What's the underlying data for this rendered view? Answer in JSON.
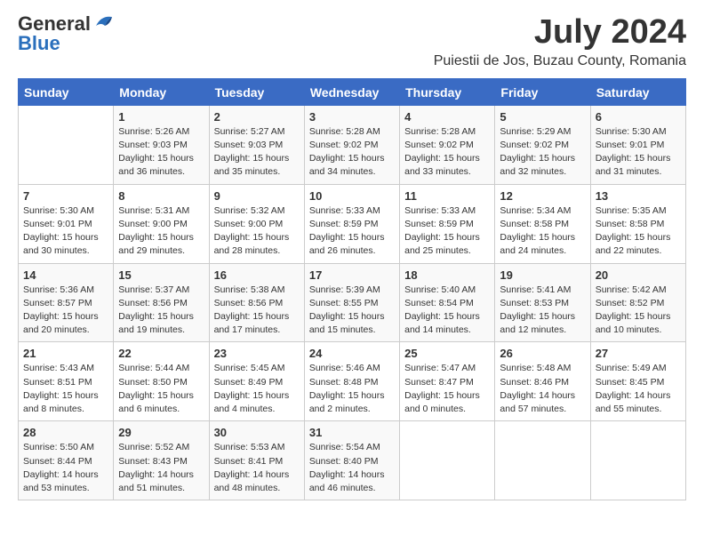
{
  "header": {
    "logo_general": "General",
    "logo_blue": "Blue",
    "month": "July 2024",
    "location": "Puiestii de Jos, Buzau County, Romania"
  },
  "weekdays": [
    "Sunday",
    "Monday",
    "Tuesday",
    "Wednesday",
    "Thursday",
    "Friday",
    "Saturday"
  ],
  "weeks": [
    [
      {
        "day": "",
        "info": ""
      },
      {
        "day": "1",
        "info": "Sunrise: 5:26 AM\nSunset: 9:03 PM\nDaylight: 15 hours\nand 36 minutes."
      },
      {
        "day": "2",
        "info": "Sunrise: 5:27 AM\nSunset: 9:03 PM\nDaylight: 15 hours\nand 35 minutes."
      },
      {
        "day": "3",
        "info": "Sunrise: 5:28 AM\nSunset: 9:02 PM\nDaylight: 15 hours\nand 34 minutes."
      },
      {
        "day": "4",
        "info": "Sunrise: 5:28 AM\nSunset: 9:02 PM\nDaylight: 15 hours\nand 33 minutes."
      },
      {
        "day": "5",
        "info": "Sunrise: 5:29 AM\nSunset: 9:02 PM\nDaylight: 15 hours\nand 32 minutes."
      },
      {
        "day": "6",
        "info": "Sunrise: 5:30 AM\nSunset: 9:01 PM\nDaylight: 15 hours\nand 31 minutes."
      }
    ],
    [
      {
        "day": "7",
        "info": "Sunrise: 5:30 AM\nSunset: 9:01 PM\nDaylight: 15 hours\nand 30 minutes."
      },
      {
        "day": "8",
        "info": "Sunrise: 5:31 AM\nSunset: 9:00 PM\nDaylight: 15 hours\nand 29 minutes."
      },
      {
        "day": "9",
        "info": "Sunrise: 5:32 AM\nSunset: 9:00 PM\nDaylight: 15 hours\nand 28 minutes."
      },
      {
        "day": "10",
        "info": "Sunrise: 5:33 AM\nSunset: 8:59 PM\nDaylight: 15 hours\nand 26 minutes."
      },
      {
        "day": "11",
        "info": "Sunrise: 5:33 AM\nSunset: 8:59 PM\nDaylight: 15 hours\nand 25 minutes."
      },
      {
        "day": "12",
        "info": "Sunrise: 5:34 AM\nSunset: 8:58 PM\nDaylight: 15 hours\nand 24 minutes."
      },
      {
        "day": "13",
        "info": "Sunrise: 5:35 AM\nSunset: 8:58 PM\nDaylight: 15 hours\nand 22 minutes."
      }
    ],
    [
      {
        "day": "14",
        "info": "Sunrise: 5:36 AM\nSunset: 8:57 PM\nDaylight: 15 hours\nand 20 minutes."
      },
      {
        "day": "15",
        "info": "Sunrise: 5:37 AM\nSunset: 8:56 PM\nDaylight: 15 hours\nand 19 minutes."
      },
      {
        "day": "16",
        "info": "Sunrise: 5:38 AM\nSunset: 8:56 PM\nDaylight: 15 hours\nand 17 minutes."
      },
      {
        "day": "17",
        "info": "Sunrise: 5:39 AM\nSunset: 8:55 PM\nDaylight: 15 hours\nand 15 minutes."
      },
      {
        "day": "18",
        "info": "Sunrise: 5:40 AM\nSunset: 8:54 PM\nDaylight: 15 hours\nand 14 minutes."
      },
      {
        "day": "19",
        "info": "Sunrise: 5:41 AM\nSunset: 8:53 PM\nDaylight: 15 hours\nand 12 minutes."
      },
      {
        "day": "20",
        "info": "Sunrise: 5:42 AM\nSunset: 8:52 PM\nDaylight: 15 hours\nand 10 minutes."
      }
    ],
    [
      {
        "day": "21",
        "info": "Sunrise: 5:43 AM\nSunset: 8:51 PM\nDaylight: 15 hours\nand 8 minutes."
      },
      {
        "day": "22",
        "info": "Sunrise: 5:44 AM\nSunset: 8:50 PM\nDaylight: 15 hours\nand 6 minutes."
      },
      {
        "day": "23",
        "info": "Sunrise: 5:45 AM\nSunset: 8:49 PM\nDaylight: 15 hours\nand 4 minutes."
      },
      {
        "day": "24",
        "info": "Sunrise: 5:46 AM\nSunset: 8:48 PM\nDaylight: 15 hours\nand 2 minutes."
      },
      {
        "day": "25",
        "info": "Sunrise: 5:47 AM\nSunset: 8:47 PM\nDaylight: 15 hours\nand 0 minutes."
      },
      {
        "day": "26",
        "info": "Sunrise: 5:48 AM\nSunset: 8:46 PM\nDaylight: 14 hours\nand 57 minutes."
      },
      {
        "day": "27",
        "info": "Sunrise: 5:49 AM\nSunset: 8:45 PM\nDaylight: 14 hours\nand 55 minutes."
      }
    ],
    [
      {
        "day": "28",
        "info": "Sunrise: 5:50 AM\nSunset: 8:44 PM\nDaylight: 14 hours\nand 53 minutes."
      },
      {
        "day": "29",
        "info": "Sunrise: 5:52 AM\nSunset: 8:43 PM\nDaylight: 14 hours\nand 51 minutes."
      },
      {
        "day": "30",
        "info": "Sunrise: 5:53 AM\nSunset: 8:41 PM\nDaylight: 14 hours\nand 48 minutes."
      },
      {
        "day": "31",
        "info": "Sunrise: 5:54 AM\nSunset: 8:40 PM\nDaylight: 14 hours\nand 46 minutes."
      },
      {
        "day": "",
        "info": ""
      },
      {
        "day": "",
        "info": ""
      },
      {
        "day": "",
        "info": ""
      }
    ]
  ]
}
